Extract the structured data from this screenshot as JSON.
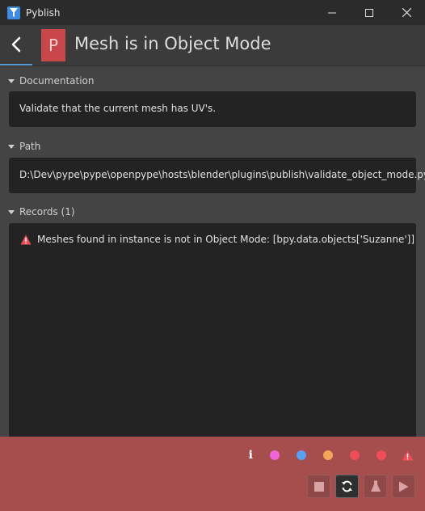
{
  "window": {
    "title": "Pyblish"
  },
  "header": {
    "badge_letter": "P",
    "title": "Mesh is in Object Mode"
  },
  "sections": {
    "documentation": {
      "label": "Documentation",
      "text": "Validate that the current mesh has UV's."
    },
    "path": {
      "label": "Path",
      "text": "D:\\Dev\\pype\\pype\\openpype\\hosts\\blender\\plugins\\publish\\validate_object_mode.py"
    },
    "records": {
      "label": "Records (1)",
      "items": [
        {
          "level": "warning",
          "message": "Meshes found in instance is not in Object Mode: [bpy.data.objects['Suzanne']]"
        }
      ]
    }
  },
  "footer": {
    "indicators": [
      {
        "icon": "info-icon",
        "color": "#ffffff"
      },
      {
        "icon": "dot",
        "color": "#f065d8"
      },
      {
        "icon": "dot",
        "color": "#5aa0f0"
      },
      {
        "icon": "dot",
        "color": "#f5a65a"
      },
      {
        "icon": "dot",
        "color": "#ef4d5a"
      },
      {
        "icon": "dot",
        "color": "#ef4d5a"
      },
      {
        "icon": "warning-triangle-icon",
        "color": "#ef4d5a"
      }
    ],
    "actions": [
      {
        "icon": "stop-icon",
        "active": false
      },
      {
        "icon": "reset-icon",
        "active": true
      },
      {
        "icon": "validate-flask-icon",
        "active": false
      },
      {
        "icon": "play-icon",
        "active": false
      }
    ]
  },
  "colors": {
    "accent_blue": "#5a9bd5",
    "badge_red": "#c8474a",
    "footer_red": "#a64d4d"
  }
}
